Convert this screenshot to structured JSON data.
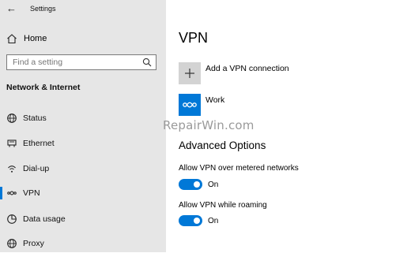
{
  "window": {
    "title": "Settings"
  },
  "sidebar": {
    "home_label": "Home",
    "search_placeholder": "Find a setting",
    "section_title": "Network & Internet",
    "items": [
      {
        "label": "Status",
        "icon": "globe-icon"
      },
      {
        "label": "Ethernet",
        "icon": "ethernet-icon"
      },
      {
        "label": "Dial-up",
        "icon": "dialup-icon"
      },
      {
        "label": "VPN",
        "icon": "vpn-icon",
        "selected": true
      },
      {
        "label": "Data usage",
        "icon": "data-usage-icon"
      },
      {
        "label": "Proxy",
        "icon": "proxy-globe-icon"
      }
    ]
  },
  "main": {
    "title": "VPN",
    "add_vpn_label": "Add a VPN connection",
    "connection_name": "Work",
    "watermark": "RepairWin.com",
    "advanced_title": "Advanced Options",
    "options": [
      {
        "label": "Allow VPN over metered networks",
        "state": "On"
      },
      {
        "label": "Allow VPN while roaming",
        "state": "On"
      }
    ]
  },
  "colors": {
    "accent": "#0078d7",
    "sidebar_bg": "#e6e6e6",
    "add_tile_bg": "#d3d3d3"
  }
}
